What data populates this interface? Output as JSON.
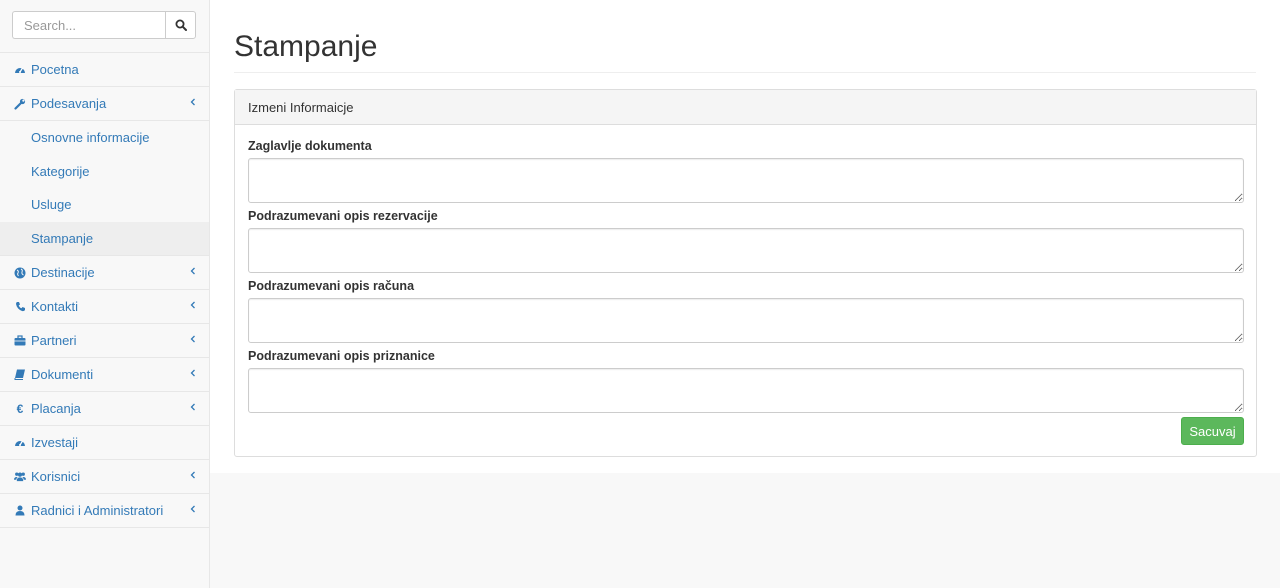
{
  "search": {
    "placeholder": "Search..."
  },
  "sidebar": {
    "items": [
      {
        "label": "Pocetna",
        "icon": "dashboard-icon"
      },
      {
        "label": "Podesavanja",
        "icon": "wrench-icon",
        "submenu": [
          "Osnovne informacije",
          "Kategorije",
          "Usluge",
          "Stampanje"
        ],
        "active_sub": "Stampanje"
      },
      {
        "label": "Destinacije",
        "icon": "globe-icon"
      },
      {
        "label": "Kontakti",
        "icon": "phone-icon"
      },
      {
        "label": "Partneri",
        "icon": "briefcase-icon"
      },
      {
        "label": "Dokumenti",
        "icon": "book-icon"
      },
      {
        "label": "Placanja",
        "icon": "euro-icon"
      },
      {
        "label": "Izvestaji",
        "icon": "dashboard-icon"
      },
      {
        "label": "Korisnici",
        "icon": "users-icon"
      },
      {
        "label": "Radnici i Administratori",
        "icon": "user-icon"
      }
    ]
  },
  "main": {
    "title": "Stampanje",
    "panel_title": "Izmeni Informaicje",
    "fields": [
      {
        "label": "Zaglavlje dokumenta",
        "value": ""
      },
      {
        "label": "Podrazumevani opis rezervacije",
        "value": ""
      },
      {
        "label": "Podrazumevani opis računa",
        "value": ""
      },
      {
        "label": "Podrazumevani opis priznanice",
        "value": ""
      }
    ],
    "save_label": "Sacuvaj"
  },
  "colors": {
    "link": "#337ab7",
    "save": "#5cb85c"
  }
}
